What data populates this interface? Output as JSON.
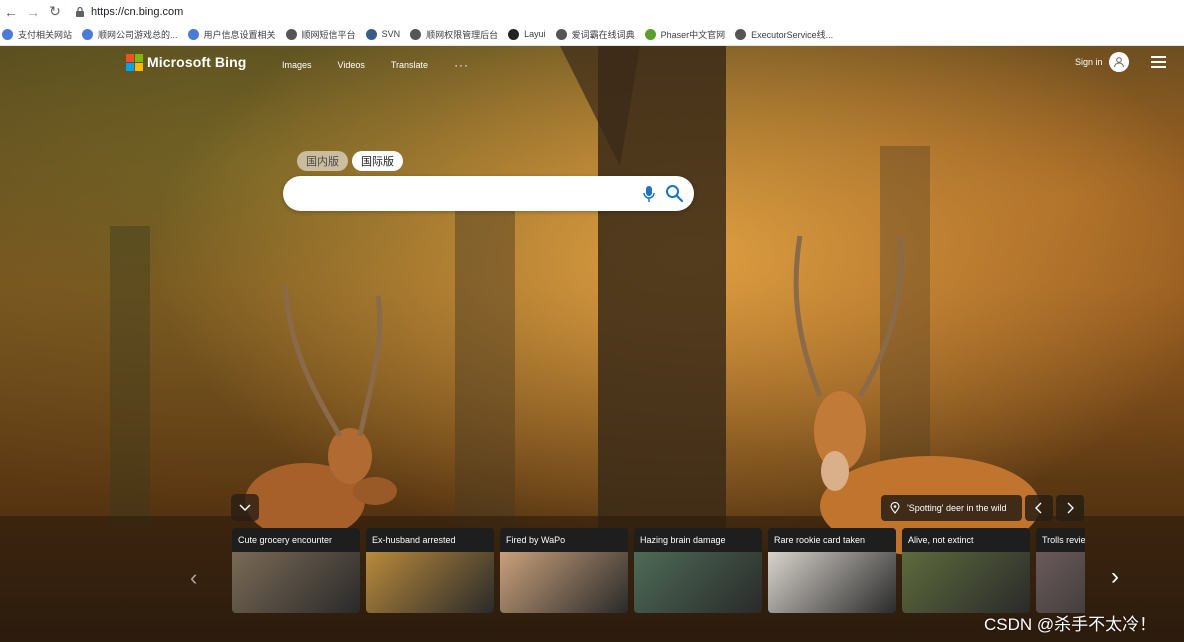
{
  "browser": {
    "url": "https://cn.bing.com",
    "nav_icons": [
      "back-icon",
      "forward-icon",
      "reload-icon"
    ]
  },
  "bookmarks": [
    {
      "label": "支付相关网站",
      "icon": "globe-icon",
      "color": "#4a7bd8"
    },
    {
      "label": "顺网公司游戏总的...",
      "icon": "globe-icon",
      "color": "#4a7bd8"
    },
    {
      "label": "用户信息设置相关",
      "icon": "globe-icon",
      "color": "#4a7bd8"
    },
    {
      "label": "顺网短信平台",
      "icon": "globe-icon",
      "color": "#555555"
    },
    {
      "label": "SVN",
      "icon": "shield-icon",
      "color": "#3b5a8a"
    },
    {
      "label": "顺网权限管理后台",
      "icon": "globe-icon",
      "color": "#555555"
    },
    {
      "label": "Layui",
      "icon": "layui-icon",
      "color": "#222222"
    },
    {
      "label": "爱词霸在线词典",
      "icon": "globe-icon",
      "color": "#555555"
    },
    {
      "label": "Phaser中文官网",
      "icon": "phaser-icon",
      "color": "#5aa02c"
    },
    {
      "label": "ExecutorService线...",
      "icon": "globe-icon",
      "color": "#555555"
    }
  ],
  "bing": {
    "logo_text": "Microsoft Bing",
    "nav": [
      "Images",
      "Videos",
      "Translate"
    ],
    "more": "···",
    "signin": "Sign in",
    "region_cn": "国内版",
    "region_intl": "国际版",
    "search_value": ""
  },
  "image_info": "'Spotting' deer in the wild",
  "cards": [
    {
      "title": "Cute grocery encounter",
      "color": "#7a6a55"
    },
    {
      "title": "Ex-husband arrested",
      "color": "#b98a3a"
    },
    {
      "title": "Fired by WaPo",
      "color": "#c9a07a"
    },
    {
      "title": "Hazing brain damage",
      "color": "#4d6b57"
    },
    {
      "title": "Rare rookie card taken",
      "color": "#d8d3cc"
    },
    {
      "title": "Alive, not extinct",
      "color": "#5d6b3c"
    },
    {
      "title": "Trolls review",
      "color": "#6a5a5a"
    }
  ],
  "watermark": "CSDN @杀手不太冷！",
  "colors": {
    "ms_red": "#f25022",
    "ms_green": "#7fba00",
    "ms_blue": "#00a4ef",
    "ms_yellow": "#ffb900",
    "search_icon_blue": "#1a73c9"
  }
}
